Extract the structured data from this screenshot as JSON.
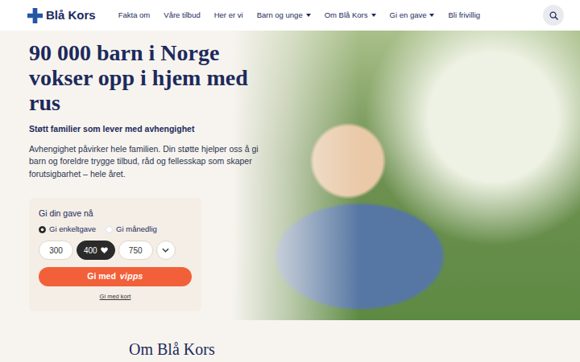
{
  "header": {
    "logo": "Blå Kors",
    "nav": [
      {
        "label": "Fakta om",
        "dropdown": false
      },
      {
        "label": "Våre tilbud",
        "dropdown": false
      },
      {
        "label": "Her er vi",
        "dropdown": false
      },
      {
        "label": "Barn og unge",
        "dropdown": true
      },
      {
        "label": "Om Blå Kors",
        "dropdown": true
      },
      {
        "label": "Gi en gave",
        "dropdown": true
      },
      {
        "label": "Bli frivillig",
        "dropdown": false
      }
    ]
  },
  "hero": {
    "title": "90 000 barn i Norge vokser opp i hjem med rus",
    "subtitle": "Støtt familier som lever med avhengighet",
    "text": "Avhengighet påvirker hele familien. Din støtte hjelper oss å gi barn og foreldre trygge tilbud, råd og fellesskap som skaper forutsigbarhet – hele året."
  },
  "donation": {
    "title": "Gi din gave nå",
    "frequency": [
      {
        "label": "Gi enkeltgave",
        "selected": true
      },
      {
        "label": "Gi månedlig",
        "selected": false
      }
    ],
    "amounts": [
      {
        "label": "300",
        "selected": false
      },
      {
        "label": "400",
        "selected": true
      },
      {
        "label": "750",
        "selected": false
      }
    ],
    "vipps": {
      "label": "Gi med",
      "brand": "vipps"
    },
    "card_link": "Gi med kort"
  },
  "section": {
    "title": "Om Blå Kors"
  }
}
